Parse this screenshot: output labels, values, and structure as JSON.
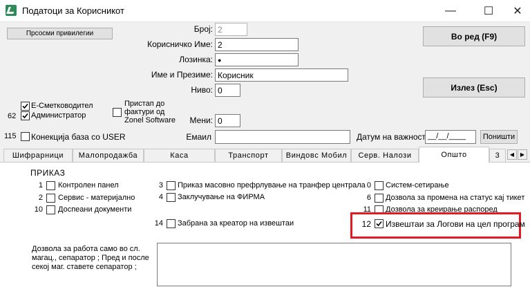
{
  "window": {
    "title": "Податоци за Корисникот",
    "minimize": "—",
    "maximize": "☐",
    "close": "✕"
  },
  "buttons": {
    "view_privileges": "Прсосми привилегии",
    "ok": "Во ред (F9)",
    "exit": "Излез (Esc)",
    "clear": "Поништи"
  },
  "form": {
    "number_label": "Број:",
    "number_value": "2",
    "username_label": "Корисничко Име:",
    "username_value": "2",
    "password_label": "Лозинка:",
    "password_value": "●",
    "fullname_label": "Име и Презиме:",
    "fullname_value": "Корисник",
    "level_label": "Ниво:",
    "level_value": "0",
    "menus_label": "Мени:",
    "menus_value": "0",
    "email_label": "Емаил",
    "email_value": "",
    "valid_date_label": "Датум на важност",
    "valid_date_value": "__/__/____"
  },
  "checks_top": {
    "accountant_label": "Е-Сметководител",
    "accountant_checked": true,
    "admin_num": "62",
    "admin_label": "Администратор",
    "admin_checked": true,
    "invoice_access_label": "Пристап до фактури од Zonel Software",
    "invoice_access_checked": false,
    "conn_num": "115",
    "conn_label": "Конекција база со USER",
    "conn_checked": false
  },
  "tabs": [
    {
      "label": "Шифрарници"
    },
    {
      "label": "Малопродажба"
    },
    {
      "label": "Каса"
    },
    {
      "label": "Транспорт"
    },
    {
      "label": "Виндовс Мобил"
    },
    {
      "label": "Серв. Налози"
    },
    {
      "label": "Општо"
    },
    {
      "label": "3"
    }
  ],
  "scroll": {
    "left": "◀",
    "right": "▶"
  },
  "panel": {
    "heading": "ПРИКАЗ",
    "items": [
      {
        "num": "1",
        "label": "Контролен панел",
        "checked": false
      },
      {
        "num": "2",
        "label": "Сервис - материјално",
        "checked": false
      },
      {
        "num": "10",
        "label": "Доспеани документи",
        "checked": false
      },
      {
        "num": "3",
        "label": "Приказ масовно префрлување на транфер централа",
        "checked": false
      },
      {
        "num": "4",
        "label": "Заклучување на ФИРМА",
        "checked": false
      },
      {
        "num": "14",
        "label": "Забрана за креатор на извештаи",
        "checked": false
      },
      {
        "num": "0",
        "label": "Систем-сетирање",
        "checked": false
      },
      {
        "num": "6",
        "label": "Дозвола за промена на статус кај тикет",
        "checked": false
      },
      {
        "num": "11",
        "label": "Дозвола за креирање распоред",
        "checked": false
      },
      {
        "num": "12",
        "label": "Извештаи за Логови на цел програм",
        "checked": true
      }
    ],
    "note": "Дозвола за работа само во сл. магац., сепаратор ; Пред и после секој маг. ставете сепаратор ;"
  }
}
